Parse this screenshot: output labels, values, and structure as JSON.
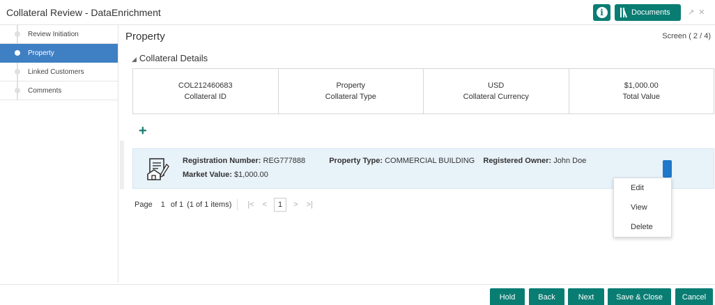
{
  "window": {
    "title": "Collateral Review - DataEnrichment",
    "info_icon": "i",
    "documents_label": "Documents",
    "window_controls": "↗↙ ✕"
  },
  "sidebar": {
    "items": [
      {
        "label": "Review Initiation"
      },
      {
        "label": "Property"
      },
      {
        "label": "Linked Customers"
      },
      {
        "label": "Comments"
      }
    ]
  },
  "main": {
    "page_title": "Property",
    "screen_indicator": "Screen ( 2 / 4)",
    "section_title": "Collateral Details",
    "summary": [
      {
        "value": "COL212460683",
        "label": "Collateral ID"
      },
      {
        "value": "Property",
        "label": "Collateral Type"
      },
      {
        "value": "USD",
        "label": "Collateral Currency"
      },
      {
        "value": "$1,000.00",
        "label": "Total Value"
      }
    ],
    "add_icon": "+",
    "record": {
      "reg_label": "Registration Number:",
      "reg_value": "REG777888",
      "type_label": "Property Type:",
      "type_value": "COMMERCIAL BUILDING",
      "owner_label": "Registered Owner:",
      "owner_value": "John Doe",
      "market_label": "Market Value:",
      "market_value": "$1,000.00"
    },
    "pager": {
      "page_label": "Page",
      "page_number": "1",
      "of_text": "of 1",
      "items_text": "(1 of 1 items)",
      "first": "|<",
      "prev": "<",
      "current": "1",
      "next": ">",
      "last": ">|"
    },
    "context_menu": [
      "Edit",
      "View",
      "Delete"
    ]
  },
  "footer": {
    "buttons": [
      "Hold",
      "Back",
      "Next",
      "Save & Close",
      "Cancel"
    ]
  },
  "colors": {
    "primary": "#0a7d73",
    "active_nav": "#3f7fc4",
    "record_bg": "#e8f2f9",
    "kebab": "#1f78c8"
  }
}
